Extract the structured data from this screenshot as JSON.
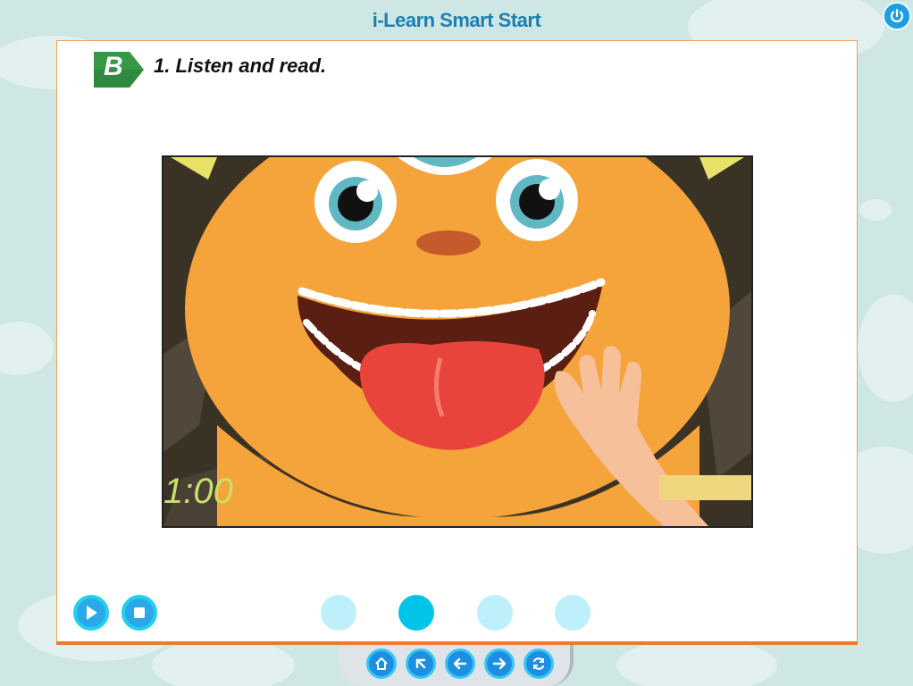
{
  "app": {
    "title": "i-Learn Smart Start"
  },
  "lesson": {
    "badge": "B",
    "heading": "1. Listen and read."
  },
  "video": {
    "timer": "1:00"
  },
  "controls": {
    "play": "play-icon",
    "stop": "stop-icon"
  },
  "pager": {
    "count": 4,
    "active_index": 2
  },
  "nav": [
    "home-icon",
    "up-icon",
    "back-icon",
    "forward-icon",
    "refresh-icon"
  ],
  "colors": {
    "title": "#1d7fb1",
    "badge": "#2e8a3e",
    "accent_border": "#f07a2c",
    "control": "#2aa8e8",
    "dot_active": "#00c4ea",
    "dot_inactive": "#bdf0fb",
    "monster": "#f5a43c"
  }
}
